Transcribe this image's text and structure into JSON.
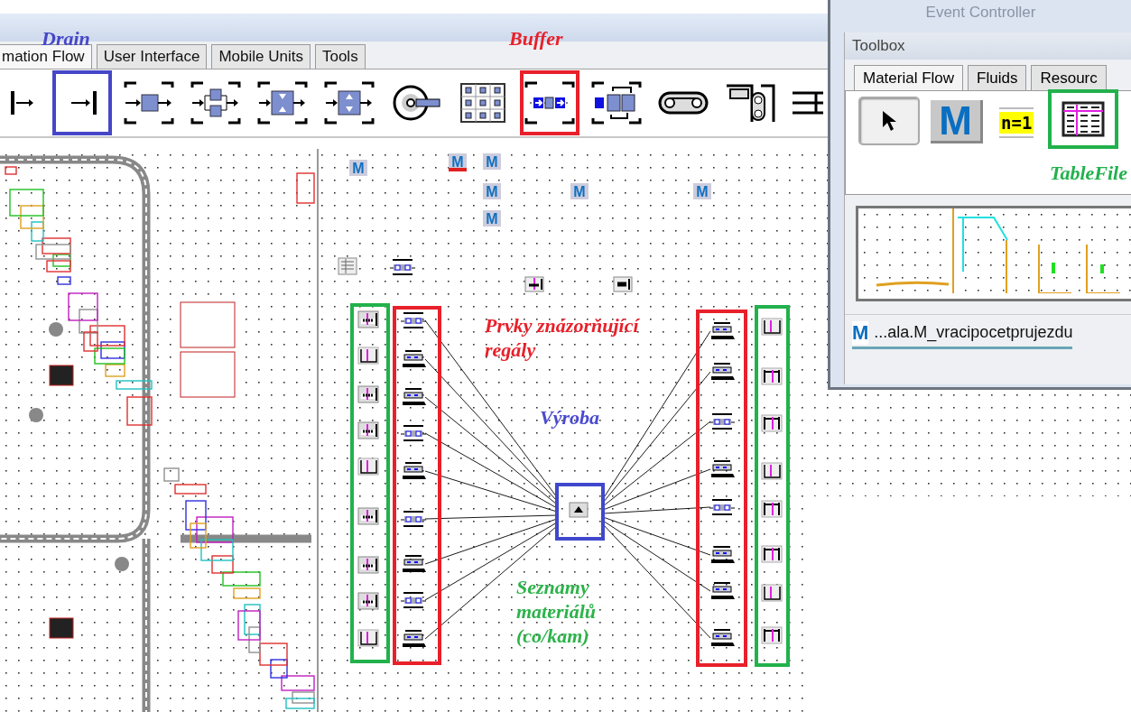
{
  "library": {
    "tabs": [
      {
        "label": "mation Flow",
        "selected": true
      },
      {
        "label": "User Interface",
        "selected": false
      },
      {
        "label": "Mobile Units",
        "selected": false
      },
      {
        "label": "Tools",
        "selected": false
      }
    ],
    "toolbar": [
      {
        "kind": "source"
      },
      {
        "kind": "drain",
        "annotation": {
          "label": "Drain",
          "color": "#4646c8"
        }
      },
      {
        "kind": "single"
      },
      {
        "kind": "parallel"
      },
      {
        "kind": "assembly"
      },
      {
        "kind": "dismantle"
      },
      {
        "kind": "cycle"
      },
      {
        "kind": "store"
      },
      {
        "kind": "buffer",
        "annotation": {
          "label": "Buffer",
          "color": "#e8202a"
        }
      },
      {
        "kind": "sorter"
      },
      {
        "kind": "line"
      },
      {
        "kind": "track"
      },
      {
        "kind": "turntable"
      }
    ]
  },
  "canvas": {
    "methods": [
      {
        "kind": "method",
        "glyph": "M"
      },
      {
        "kind": "init_method",
        "glyph": "M"
      },
      {
        "kind": "method",
        "glyph": "M"
      },
      {
        "kind": "method",
        "glyph": "M"
      },
      {
        "kind": "method",
        "glyph": "M"
      },
      {
        "kind": "method",
        "glyph": "M"
      },
      {
        "kind": "method",
        "glyph": "M"
      }
    ],
    "objects": [
      {
        "kind": "table"
      },
      {
        "kind": "buffer"
      },
      {
        "kind": "list"
      },
      {
        "kind": "queue"
      }
    ],
    "groups": [
      {
        "color": "#22b14c",
        "items": [
          {
            "kind": "full_list"
          },
          {
            "kind": "empty_list"
          },
          {
            "kind": "full_list"
          },
          {
            "kind": "full_list"
          },
          {
            "kind": "empty_list"
          },
          {
            "kind": "full_list"
          },
          {
            "kind": "full_list"
          },
          {
            "kind": "full_list"
          },
          {
            "kind": "empty_list"
          }
        ]
      },
      {
        "color": "#e8202a",
        "items": [
          {
            "kind": "buffer"
          },
          {
            "kind": "store"
          },
          {
            "kind": "store"
          },
          {
            "kind": "buffer"
          },
          {
            "kind": "store"
          },
          {
            "kind": "buffer"
          },
          {
            "kind": "store"
          },
          {
            "kind": "buffer"
          },
          {
            "kind": "store"
          }
        ]
      },
      {
        "color": "#e8202a",
        "items": [
          {
            "kind": "store"
          },
          {
            "kind": "store"
          },
          {
            "kind": "buffer"
          },
          {
            "kind": "store"
          },
          {
            "kind": "buffer"
          },
          {
            "kind": "store"
          },
          {
            "kind": "store"
          },
          {
            "kind": "store"
          }
        ]
      },
      {
        "color": "#22b14c",
        "items": [
          {
            "kind": "empty_list"
          },
          {
            "kind": "bar_list"
          },
          {
            "kind": "bar_list"
          },
          {
            "kind": "empty_list"
          },
          {
            "kind": "bar_list"
          },
          {
            "kind": "bar_list"
          },
          {
            "kind": "empty_list"
          },
          {
            "kind": "bar_list"
          }
        ]
      }
    ],
    "production": {
      "color": "#3f48cc"
    },
    "annotations": [
      {
        "text": "Prvky znázorňující regály",
        "color": "#e8202a"
      },
      {
        "text": "Výroba",
        "color": "#4a4ad0"
      },
      {
        "text": "Seznamy materiálů (co/kam)",
        "color": "#2db34a"
      }
    ]
  },
  "toolbox": {
    "window_title": "Event Controller",
    "title": "Toolbox",
    "tabs": [
      {
        "label": "Material Flow",
        "selected": true
      },
      {
        "label": "Fluids",
        "selected": false
      },
      {
        "label": "Resourc",
        "selected": false
      }
    ],
    "items": [
      {
        "kind": "pointer",
        "selected": true
      },
      {
        "kind": "method",
        "glyph": "M",
        "selected": false
      },
      {
        "kind": "variable",
        "text": "n=1",
        "selected": false
      },
      {
        "kind": "tablefile",
        "selected": false,
        "annotation": {
          "label": "TableFile",
          "color": "#22b14c"
        }
      }
    ],
    "open_tab": {
      "glyph": "M",
      "label": "...ala.M_vracipocetprujezdu"
    }
  }
}
